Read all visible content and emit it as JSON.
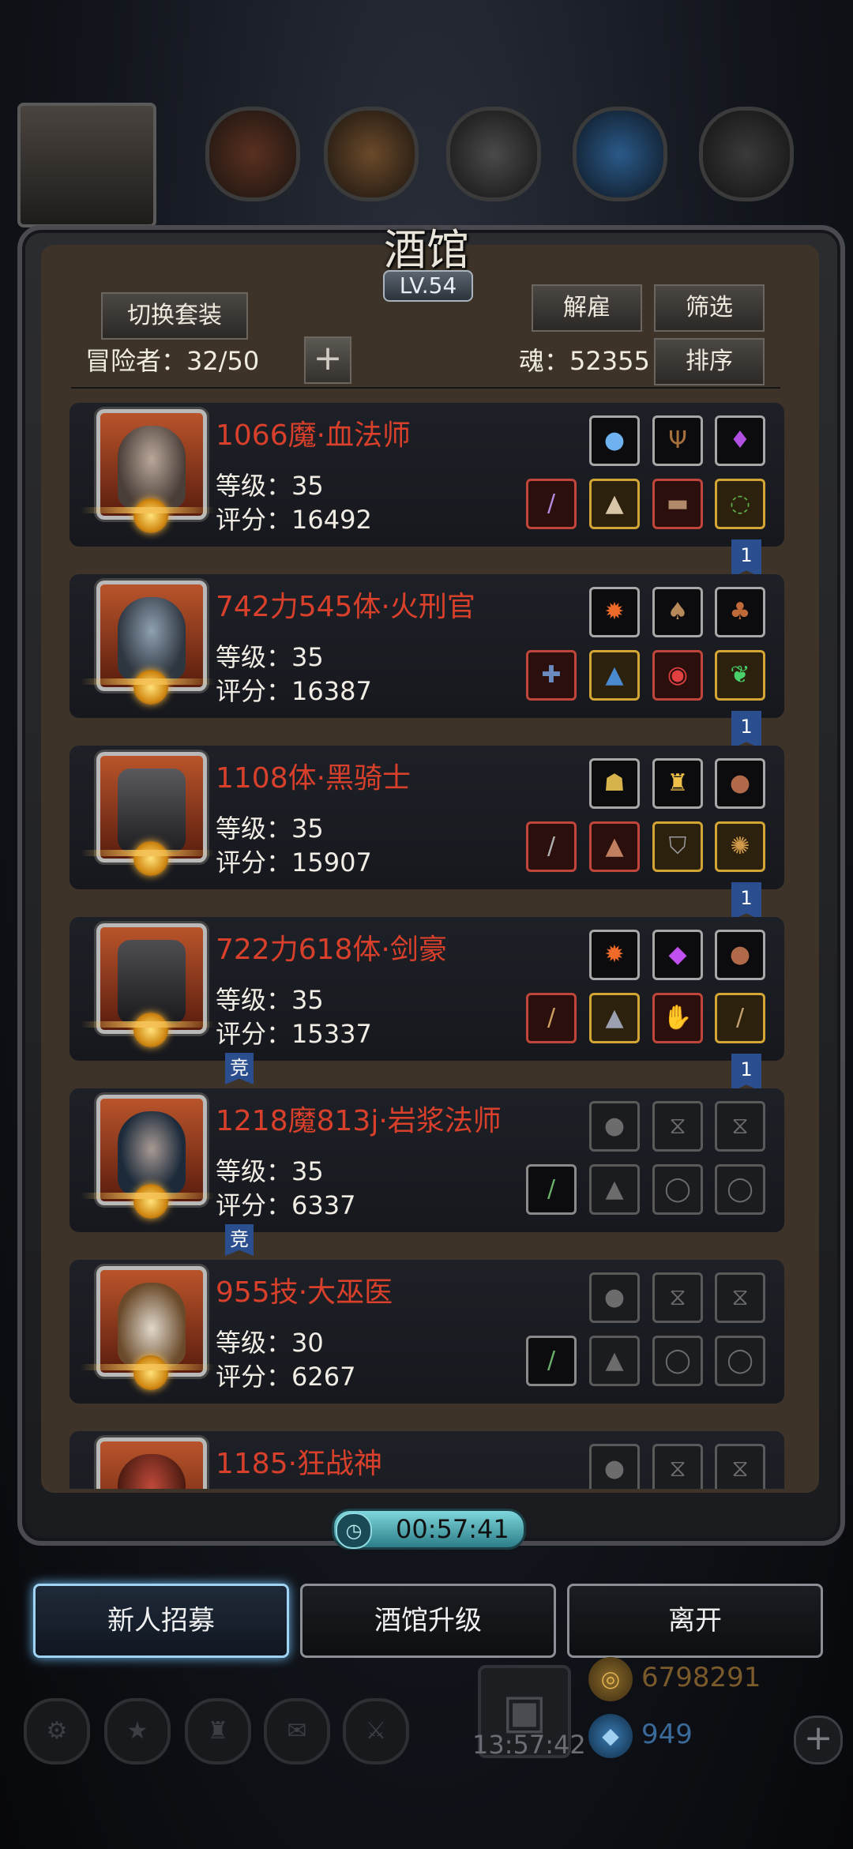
{
  "panel": {
    "title": "酒馆",
    "level": "LV.54",
    "switch_outfit_label": "切换套装",
    "dismiss_label": "解雇",
    "filter_label": "筛选",
    "sort_label": "排序",
    "adventurers_label": "冒险者：32/50",
    "soul_label": "魂：52355"
  },
  "heroes": [
    {
      "name": "1066魔·血法师",
      "level": "等级：35",
      "score": "评分：16492",
      "tag": "1"
    },
    {
      "name": "742力545体·火刑官",
      "level": "等级：35",
      "score": "评分：16387",
      "tag": "1"
    },
    {
      "name": "1108体·黑骑士",
      "level": "等级：35",
      "score": "评分：15907",
      "tag": "1"
    },
    {
      "name": "722力618体·剑豪",
      "level": "等级：35",
      "score": "评分：15337",
      "tag": "1",
      "badge": "竞"
    },
    {
      "name": "1218魔813j·岩浆法师",
      "level": "等级：35",
      "score": "评分：6337",
      "badge": "竞"
    },
    {
      "name": "955技·大巫医",
      "level": "等级：30",
      "score": "评分：6267"
    },
    {
      "name": "1185·狂战神"
    }
  ],
  "timer": "00:57:41",
  "actions": {
    "recruit": "新人招募",
    "upgrade": "酒馆升级",
    "leave": "离开"
  },
  "bottom": {
    "gift_timer": "13:57:42",
    "gold": "6798291",
    "gems": "949"
  },
  "colors": {
    "name_red": "#d9402b",
    "tag_blue": "#2b4e8f",
    "timer_teal": "#5cbcc6"
  }
}
